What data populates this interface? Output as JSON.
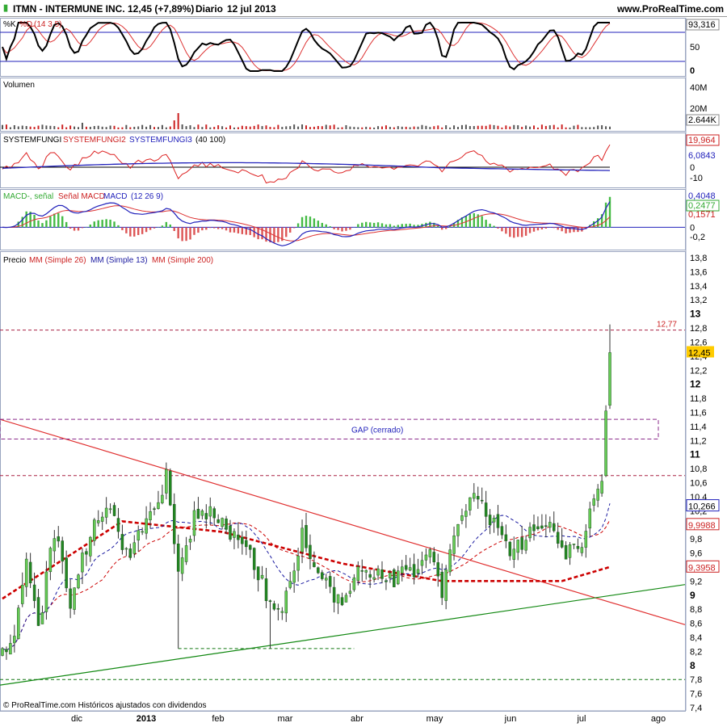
{
  "header": {
    "ticker": "ITMN - INTERMUNE INC.",
    "quote": "12,45 (+7,89%)",
    "period": "Diario",
    "date": "12 jul 2013",
    "site": "www.ProRealTime.com"
  },
  "footer": {
    "note": "© ProRealTime.com Históricos ajustados con dividendos"
  },
  "colors": {
    "up": "#33aa33",
    "down": "#cc2222",
    "ma26": "#cc0000",
    "ma13": "#1a1aa0",
    "ma200": "#cc0000",
    "blue": "#2222bb",
    "green": "#117711"
  },
  "panels": {
    "stoch": {
      "title_k": "%K",
      "title_d": "%D",
      "title_params": "(14 3 5)",
      "ticks": [
        "93,316",
        "50",
        "0"
      ],
      "last": "93,316"
    },
    "volume": {
      "title": "Volumen",
      "ticks": [
        "40M",
        "20M"
      ],
      "last": "2.644K"
    },
    "system": {
      "title1": "SYSTEMFUNGI",
      "title2": "SYSTEMFUNGI2",
      "title3": "SYSTEMFUNGI3",
      "params": "(40 100)",
      "ticks": [
        "0",
        "-10"
      ],
      "last_red": "19,964",
      "last_blue": "6,0843"
    },
    "macd": {
      "title1": "MACD-, señal",
      "title2": "Señal MACD",
      "title3": "MACD",
      "params": "(12 26 9)",
      "ticks": [
        "0",
        "-0,2"
      ],
      "last_blue": "0,4048",
      "last_green": "0,2477",
      "last_red": "0,1571"
    },
    "price": {
      "title": "Precio",
      "ma26": "MM (Simple 26)",
      "ma13": "MM (Simple 13)",
      "ma200": "MM (Simple 200)"
    }
  },
  "annotations": {
    "resistance": "12,77",
    "gap": "GAP (cerrado)"
  },
  "price_labels": {
    "last": "12,45",
    "ma13": "10,266",
    "ma26": "9,9988",
    "ma200": "9,3958"
  },
  "x_labels": [
    "dic",
    "2013",
    "feb",
    "mar",
    "abr",
    "may",
    "jun",
    "jul",
    "ago"
  ],
  "chart_data": {
    "type": "candlestick",
    "title": "ITMN - INTERMUNE INC.",
    "ylim": [
      7.4,
      13.8
    ],
    "y_ticks": [
      "13,8",
      "13,6",
      "13,4",
      "13,2",
      "13",
      "12,8",
      "12,6",
      "12,4",
      "12,2",
      "12",
      "11,8",
      "11,6",
      "11,4",
      "11,2",
      "11",
      "10,8",
      "10,6",
      "10,4",
      "10,2",
      "10",
      "9,8",
      "9,6",
      "9,4",
      "9,2",
      "9",
      "8,8",
      "8,6",
      "8,4",
      "8,2",
      "8",
      "7,8",
      "7,6",
      "7,4"
    ],
    "x_months": [
      "dic",
      "2013",
      "feb",
      "mar",
      "abr",
      "may",
      "jun",
      "jul",
      "ago"
    ],
    "close_waypoints": [
      [
        0,
        8.15
      ],
      [
        3,
        8.5
      ],
      [
        6,
        9.4
      ],
      [
        9,
        8.5
      ],
      [
        13,
        9.9
      ],
      [
        17,
        8.9
      ],
      [
        22,
        9.9
      ],
      [
        27,
        10.25
      ],
      [
        31,
        9.55
      ],
      [
        36,
        9.95
      ],
      [
        41,
        10.65
      ],
      [
        44,
        9.25
      ],
      [
        48,
        10.15
      ],
      [
        53,
        10.15
      ],
      [
        58,
        9.8
      ],
      [
        63,
        9.5
      ],
      [
        67,
        8.9
      ],
      [
        70,
        8.7
      ],
      [
        75,
        9.85
      ],
      [
        80,
        9.15
      ],
      [
        85,
        8.95
      ],
      [
        90,
        9.45
      ],
      [
        96,
        9.15
      ],
      [
        102,
        9.35
      ],
      [
        107,
        9.55
      ],
      [
        110,
        9.1
      ],
      [
        112,
        9.6
      ],
      [
        117,
        10.4
      ],
      [
        120,
        10.3
      ],
      [
        125,
        9.75
      ],
      [
        128,
        9.6
      ],
      [
        132,
        9.9
      ],
      [
        136,
        10.0
      ],
      [
        141,
        9.6
      ],
      [
        145,
        9.75
      ],
      [
        148,
        10.4
      ],
      [
        150,
        10.8
      ],
      [
        151,
        11.7
      ],
      [
        152,
        12.45
      ]
    ],
    "last_candle": {
      "open": 11.7,
      "high": 12.85,
      "low": 11.65,
      "close": 12.45
    },
    "levels": {
      "resistance": 12.77,
      "gap_top": 11.5,
      "gap_bottom": 11.22,
      "support_low": 8.24,
      "level_10_7": 10.7,
      "level_7_8": 7.8
    },
    "indicators": [
      "MM (Simple 26)",
      "MM (Simple 13)",
      "MM (Simple 200)"
    ],
    "stochastic": {
      "k_last": 93.316,
      "levels": [
        80,
        20
      ]
    },
    "volume": {
      "last": "2.644K",
      "scale_max": 40000000
    },
    "systemfungi": {
      "red_last": 19.964,
      "blue_last": 6.0843
    },
    "macd": {
      "blue_last": 0.4048,
      "green_last": 0.2477,
      "red_last": 0.1571
    }
  }
}
